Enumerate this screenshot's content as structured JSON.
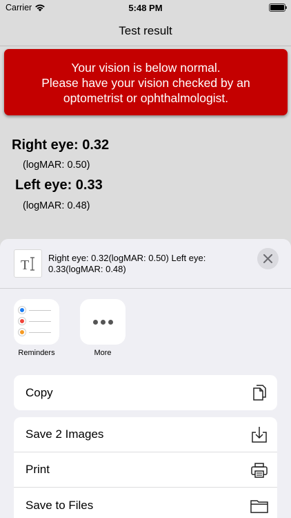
{
  "status": {
    "carrier": "Carrier",
    "time": "5:48 PM"
  },
  "nav": {
    "title": "Test result"
  },
  "alert": {
    "line1": "Your vision is below normal.",
    "line2": "Please have your vision checked by an",
    "line3": "optometrist or ophthalmologist.",
    "color": "#c40000"
  },
  "results": {
    "right_eye": "Right eye: 0.32",
    "right_logmar": "(logMAR:  0.50)",
    "left_eye": "Left eye: 0.33",
    "left_logmar": "(logMAR:  0.48)"
  },
  "share": {
    "thumb_icon": "text-cursor-icon",
    "text": "Right eye: 0.32(logMAR:  0.50) Left eye: 0.33(logMAR:  0.48)",
    "apps": [
      {
        "label": "Reminders",
        "icon": "reminders-icon"
      },
      {
        "label": "More",
        "icon": "more-icon"
      }
    ],
    "actions_group1": [
      {
        "label": "Copy",
        "icon": "copy-icon"
      }
    ],
    "actions_group2": [
      {
        "label": "Save 2 Images",
        "icon": "save-image-icon"
      },
      {
        "label": "Print",
        "icon": "printer-icon"
      },
      {
        "label": "Save to Files",
        "icon": "folder-icon"
      }
    ]
  }
}
